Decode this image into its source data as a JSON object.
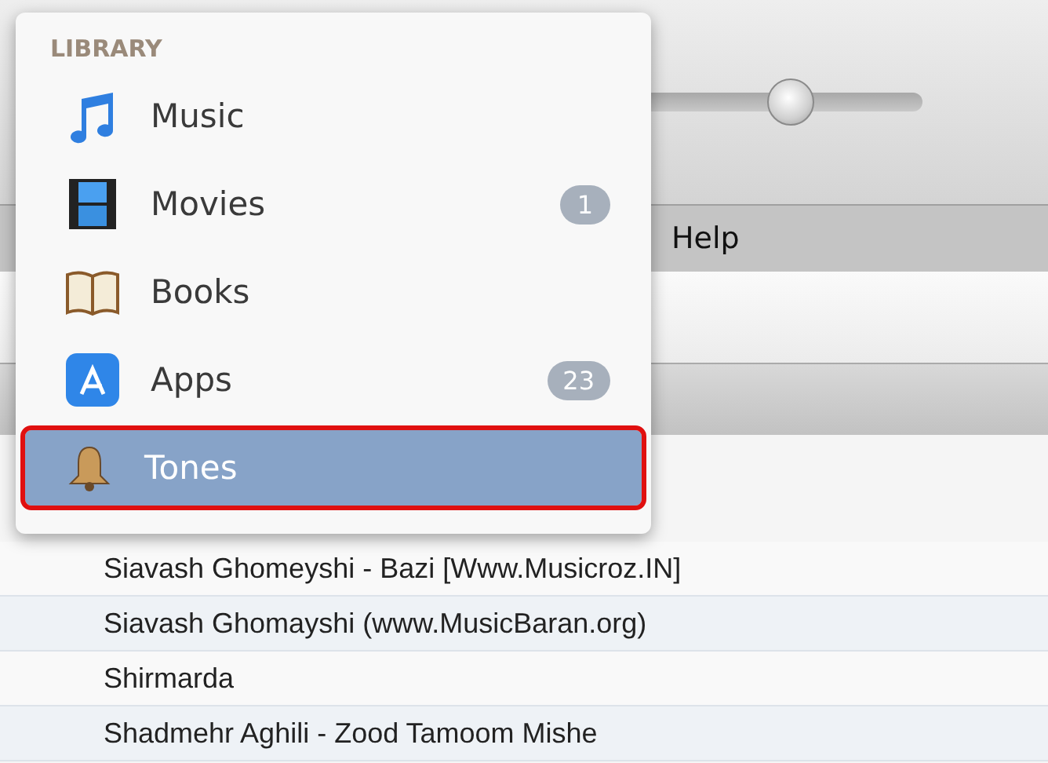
{
  "player": {
    "volume": {
      "level": 0.57
    }
  },
  "menu_bar": {
    "items": [
      "Help"
    ]
  },
  "library_popup": {
    "header": "LIBRARY",
    "items": [
      {
        "kind": "music",
        "label": "Music",
        "selected": false
      },
      {
        "kind": "movies",
        "label": "Movies",
        "badge": "1",
        "selected": false
      },
      {
        "kind": "books",
        "label": "Books",
        "selected": false
      },
      {
        "kind": "apps",
        "label": "Apps",
        "badge": "23",
        "selected": false
      },
      {
        "kind": "tones",
        "label": "Tones",
        "selected": true
      }
    ]
  },
  "song_list": {
    "rows": [
      "Siavash Ghomeyshi - Bazi [Www.Musicroz.IN]",
      "Siavash Ghomayshi (www.MusicBaran.org)",
      "Shirmarda",
      "Shadmehr Aghili - Zood Tamoom Mishe"
    ]
  }
}
